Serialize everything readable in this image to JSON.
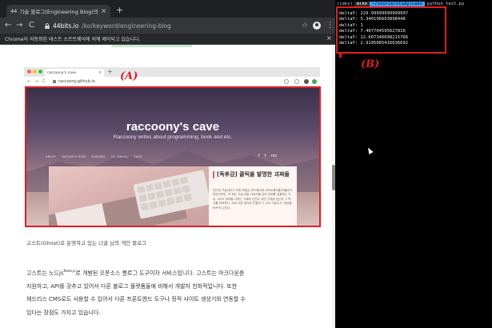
{
  "browser": {
    "tab": {
      "favicon_text": "44",
      "title": "기술 블로그(Engineering Blog)의 ...",
      "close_glyph": "×"
    },
    "new_tab_glyph": "+",
    "nav": {
      "back": "←",
      "forward": "→",
      "reload": "C"
    },
    "url": {
      "host": "44bits.io",
      "path": "/ko/keyword/engineering-blog"
    },
    "toolbar_icons": {
      "star": "☆",
      "menu": "⋮"
    },
    "infobar": {
      "text": "Chrome이 자동화된 테스트 소프트웨어에 의해 제어되고 있습니다.",
      "close_glyph": "×"
    }
  },
  "inner_screenshot": {
    "tab": {
      "title": "raccoony's cave",
      "close_glyph": "×"
    },
    "new_tab_glyph": "+",
    "nav": {
      "back": "←",
      "forward": "→",
      "reload": "C"
    },
    "url": "raccoony.github.io",
    "hero": {
      "title": "raccoony's cave",
      "tagline": "Raccoony writes about programming, book and etc.",
      "nav_items": [
        "ABOUT",
        "HACKER'S HOW",
        "READING",
        "TIL (INBOX)",
        "TAGS"
      ],
      "social_icons": [
        "f",
        "t",
        "rss"
      ]
    },
    "post": {
      "title": "[독후감] 클릭을 발명한 괴짜들",
      "excerpt": "인터넷 기술이라고 하면 보통은 하드웨어와 소프트웨어를 떠올리기 마련이지만, 이 책은 기술 개발 이야기를 넘어 정보를 연결하는 기술 그리고 정보를 다루는 기계와 인간이 어떤 관계에 있는지 그 역사를 보여준다. 서로 다른 생각과 연결과 그 사이 기술이 이 세상을 바꾸어 나갔다."
    }
  },
  "labels": {
    "a": "(A)",
    "b": "(B)"
  },
  "caption": "고스트(Ghost)로 운영하고 있는 너굴 님의 개인 블로그",
  "article": {
    "lines": [
      "고스트는 노드js",
      "지원하고, API를 갖추고 있어서 다른 블로그 플랫폼들에 비해서 개발자 친화적입니다. 또한",
      "헤드리스 CMS로도 사용할 수 있어서 다른 프론트엔드 도구나 정적 사이트 생성기와 연동할 수",
      "있다는 장점도 가지고 있습니다."
    ],
    "line1_superscript": "Node.js",
    "line1_tail": "로 개발된 오픈소스 블로그 도구이자 서비스입니다. 고스트는 마크다운을"
  },
  "terminal": {
    "prompt": {
      "env": "(caks)",
      "user": "mike",
      "path": "~/source/study/caks",
      "command": "python test.py"
    },
    "lines": [
      "deltaY: 229.99999999999997",
      "deltaY: 5.340196693898448",
      "deltaY: 1",
      "deltaY: 7.407704595627816",
      "deltaY: 12.607346698215766",
      "deltaY: 2.9195085416636692"
    ]
  },
  "colors": {
    "annotation_red": "#e11d24",
    "terminal_bg": "#000000",
    "prompt_path_bg": "#3fa0ff",
    "browser_chrome": "#35363a"
  }
}
